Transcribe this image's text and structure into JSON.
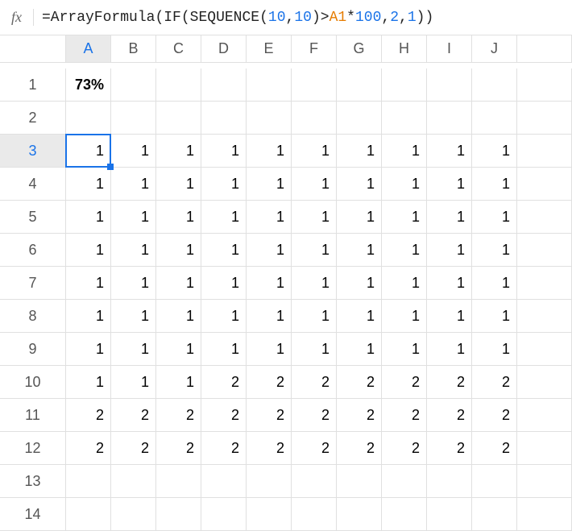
{
  "formula": {
    "parts": [
      {
        "text": "=ArrayFormula",
        "class": "f-black"
      },
      {
        "text": "(",
        "class": "f-paren"
      },
      {
        "text": "IF",
        "class": "f-black"
      },
      {
        "text": "(",
        "class": "f-paren"
      },
      {
        "text": "SEQUENCE",
        "class": "f-black"
      },
      {
        "text": "(",
        "class": "f-paren"
      },
      {
        "text": "10",
        "class": "f-blue"
      },
      {
        "text": ",",
        "class": "f-black"
      },
      {
        "text": "10",
        "class": "f-blue"
      },
      {
        "text": ")",
        "class": "f-paren"
      },
      {
        "text": ">",
        "class": "f-black"
      },
      {
        "text": "A1",
        "class": "f-orange"
      },
      {
        "text": "*",
        "class": "f-black"
      },
      {
        "text": "100",
        "class": "f-blue"
      },
      {
        "text": ",",
        "class": "f-black"
      },
      {
        "text": "2",
        "class": "f-blue"
      },
      {
        "text": ",",
        "class": "f-black"
      },
      {
        "text": "1",
        "class": "f-blue"
      },
      {
        "text": ")",
        "class": "f-paren"
      },
      {
        "text": ")",
        "class": "f-paren"
      }
    ]
  },
  "fx_label": "fx",
  "columns": [
    "A",
    "B",
    "C",
    "D",
    "E",
    "F",
    "G",
    "H",
    "I",
    "J"
  ],
  "rows": [
    "1",
    "2",
    "3",
    "4",
    "5",
    "6",
    "7",
    "8",
    "9",
    "10",
    "11",
    "12",
    "13",
    "14"
  ],
  "active_col": "A",
  "active_row": "3",
  "cells": {
    "A1": "73%",
    "A3": "1",
    "B3": "1",
    "C3": "1",
    "D3": "1",
    "E3": "1",
    "F3": "1",
    "G3": "1",
    "H3": "1",
    "I3": "1",
    "J3": "1",
    "A4": "1",
    "B4": "1",
    "C4": "1",
    "D4": "1",
    "E4": "1",
    "F4": "1",
    "G4": "1",
    "H4": "1",
    "I4": "1",
    "J4": "1",
    "A5": "1",
    "B5": "1",
    "C5": "1",
    "D5": "1",
    "E5": "1",
    "F5": "1",
    "G5": "1",
    "H5": "1",
    "I5": "1",
    "J5": "1",
    "A6": "1",
    "B6": "1",
    "C6": "1",
    "D6": "1",
    "E6": "1",
    "F6": "1",
    "G6": "1",
    "H6": "1",
    "I6": "1",
    "J6": "1",
    "A7": "1",
    "B7": "1",
    "C7": "1",
    "D7": "1",
    "E7": "1",
    "F7": "1",
    "G7": "1",
    "H7": "1",
    "I7": "1",
    "J7": "1",
    "A8": "1",
    "B8": "1",
    "C8": "1",
    "D8": "1",
    "E8": "1",
    "F8": "1",
    "G8": "1",
    "H8": "1",
    "I8": "1",
    "J8": "1",
    "A9": "1",
    "B9": "1",
    "C9": "1",
    "D9": "1",
    "E9": "1",
    "F9": "1",
    "G9": "1",
    "H9": "1",
    "I9": "1",
    "J9": "1",
    "A10": "1",
    "B10": "1",
    "C10": "1",
    "D10": "2",
    "E10": "2",
    "F10": "2",
    "G10": "2",
    "H10": "2",
    "I10": "2",
    "J10": "2",
    "A11": "2",
    "B11": "2",
    "C11": "2",
    "D11": "2",
    "E11": "2",
    "F11": "2",
    "G11": "2",
    "H11": "2",
    "I11": "2",
    "J11": "2",
    "A12": "2",
    "B12": "2",
    "C12": "2",
    "D12": "2",
    "E12": "2",
    "F12": "2",
    "G12": "2",
    "H12": "2",
    "I12": "2",
    "J12": "2"
  }
}
